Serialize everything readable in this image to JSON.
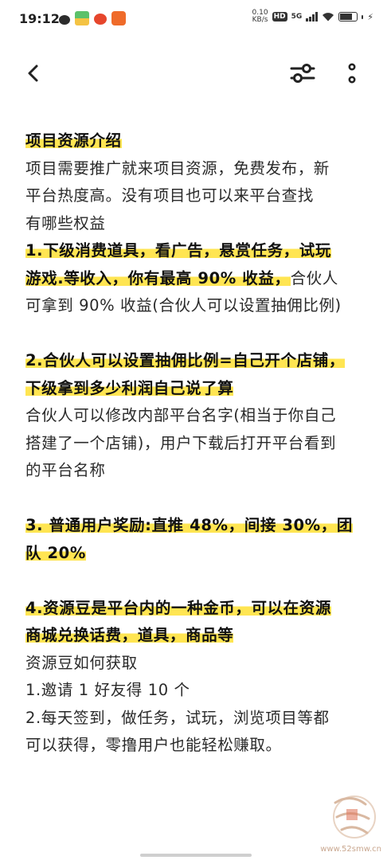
{
  "status_bar": {
    "time": "19:12",
    "net_speed_value": "0.10",
    "net_speed_unit": "KB/s",
    "hd": "HD",
    "network": "5G",
    "battery_level": 0.75,
    "icons": [
      "wechat-icon",
      "app-icon",
      "weibo-icon",
      "app-icon"
    ]
  },
  "nav": {
    "back_icon": "chevron-left-icon",
    "adjust_icon": "adjust-icon",
    "more_icon": "more-vertical-icon"
  },
  "content": {
    "section0": {
      "heading": "项目资源介绍",
      "lines": [
        "项目需要推广就来项目资源，免费发布，新",
        "平台热度高。没有项目也可以来平台查找",
        "有哪些权益"
      ]
    },
    "section1": {
      "hl_line1": "1.下级消费道具，看广告，悬赏任务，试玩",
      "hl_line2": "游戏.等收入，你有最高 90% 收益，",
      "line2_rest": "合伙人",
      "line3": "可拿到 90% 收益(合伙人可以设置抽佣比例)"
    },
    "section2": {
      "hl_line1": "2.合伙人可以设置抽佣比例=自己开个店铺，",
      "hl_line2": "下级拿到多少利润自己说了算",
      "lines": [
        "合伙人可以修改内部平台名字(相当于你自己",
        "搭建了一个店铺)，用户下载后打开平台看到",
        "的平台名称"
      ]
    },
    "section3": {
      "hl_line1": "3. 普通用户奖励:直推 48%，间接 30%，团",
      "hl_line2": "队 20%"
    },
    "section4": {
      "hl_line1": "4.资源豆是平台内的一种金币，可以在资源",
      "hl_line2": "商城兑换话费，道具，商品等",
      "lines": [
        "资源豆如何获取",
        "1.邀请 1 好友得 10 个",
        "2.每天签到，做任务，试玩，浏览项目等都",
        "可以获得，零撸用户也能轻松赚取。"
      ]
    }
  },
  "watermark": {
    "text": "www.52smw.cn",
    "color": "#c9a78f"
  },
  "colors": {
    "highlight": "#ffe552",
    "text": "#222222"
  }
}
